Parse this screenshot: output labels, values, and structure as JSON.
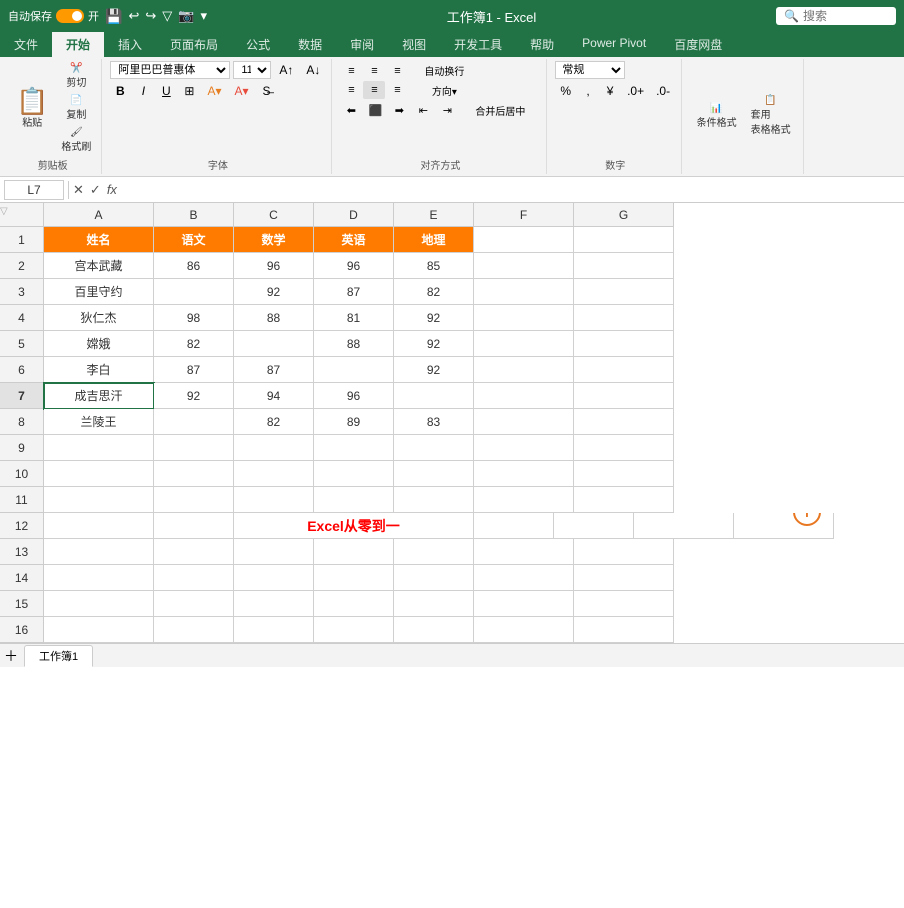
{
  "titleBar": {
    "autosave": "自动保存",
    "autosave_on": "开",
    "title": "工作簿1 - Excel",
    "search_placeholder": "搜索"
  },
  "ribbonTabs": [
    {
      "label": "文件",
      "active": false
    },
    {
      "label": "开始",
      "active": true
    },
    {
      "label": "插入",
      "active": false
    },
    {
      "label": "页面布局",
      "active": false
    },
    {
      "label": "公式",
      "active": false
    },
    {
      "label": "数据",
      "active": false
    },
    {
      "label": "审阅",
      "active": false
    },
    {
      "label": "视图",
      "active": false
    },
    {
      "label": "开发工具",
      "active": false
    },
    {
      "label": "帮助",
      "active": false
    },
    {
      "label": "Power Pivot",
      "active": false
    },
    {
      "label": "百度网盘",
      "active": false
    }
  ],
  "ribbon": {
    "paste": "粘贴",
    "cut": "剪切",
    "copy": "复制",
    "format_painter": "格式刷",
    "clipboard_label": "剪贴板",
    "font_name": "阿里巴巴普惠体",
    "font_size": "11",
    "bold": "B",
    "italic": "I",
    "underline": "U",
    "font_label": "字体",
    "wrap_text": "自动换行",
    "merge_center": "合并后居中",
    "align_label": "对齐方式",
    "number_format": "常规",
    "number_label": "数字",
    "cond_format": "条件格式",
    "cell_styles": "套用\n表格格式"
  },
  "formulaBar": {
    "cell_ref": "L7",
    "formula_content": ""
  },
  "columns": [
    "A",
    "B",
    "C",
    "D",
    "E",
    "F",
    "G"
  ],
  "headers": [
    "姓名",
    "语文",
    "数学",
    "英语",
    "地理",
    "",
    ""
  ],
  "rows": [
    {
      "row": 1,
      "cells": [
        "姓名",
        "语文",
        "数学",
        "英语",
        "地理",
        "",
        ""
      ],
      "is_header": true
    },
    {
      "row": 2,
      "cells": [
        "宫本武藏",
        "86",
        "96",
        "96",
        "85",
        "",
        ""
      ]
    },
    {
      "row": 3,
      "cells": [
        "百里守约",
        "",
        "92",
        "87",
        "82",
        "",
        ""
      ]
    },
    {
      "row": 4,
      "cells": [
        "狄仁杰",
        "98",
        "88",
        "81",
        "92",
        "",
        ""
      ]
    },
    {
      "row": 5,
      "cells": [
        "嫦娥",
        "82",
        "",
        "88",
        "92",
        "",
        ""
      ]
    },
    {
      "row": 6,
      "cells": [
        "李白",
        "87",
        "87",
        "",
        "92",
        "",
        ""
      ]
    },
    {
      "row": 7,
      "cells": [
        "成吉思汗",
        "92",
        "94",
        "96",
        "",
        "",
        ""
      ],
      "active_row": true
    },
    {
      "row": 8,
      "cells": [
        "兰陵王",
        "",
        "82",
        "89",
        "83",
        "",
        ""
      ]
    },
    {
      "row": 9,
      "cells": [
        "",
        "",
        "",
        "",
        "",
        "",
        ""
      ]
    },
    {
      "row": 10,
      "cells": [
        "",
        "",
        "",
        "",
        "",
        "",
        ""
      ]
    },
    {
      "row": 11,
      "cells": [
        "",
        "",
        "",
        "",
        "",
        "",
        ""
      ]
    },
    {
      "row": 12,
      "cells": [
        "",
        "",
        "",
        "",
        "",
        "",
        ""
      ],
      "special": "Excel从零到一"
    },
    {
      "row": 13,
      "cells": [
        "",
        "",
        "",
        "",
        "",
        "",
        ""
      ]
    },
    {
      "row": 14,
      "cells": [
        "",
        "",
        "",
        "",
        "",
        "",
        ""
      ]
    },
    {
      "row": 15,
      "cells": [
        "",
        "",
        "",
        "",
        "",
        "",
        ""
      ]
    },
    {
      "row": 16,
      "cells": [
        "",
        "",
        "",
        "",
        "",
        "",
        ""
      ]
    }
  ],
  "specialRow": 12,
  "specialText": "Excel从零到一",
  "activeCell": "L7",
  "sheetTabs": [
    {
      "label": "工作簿1",
      "active": true
    }
  ]
}
